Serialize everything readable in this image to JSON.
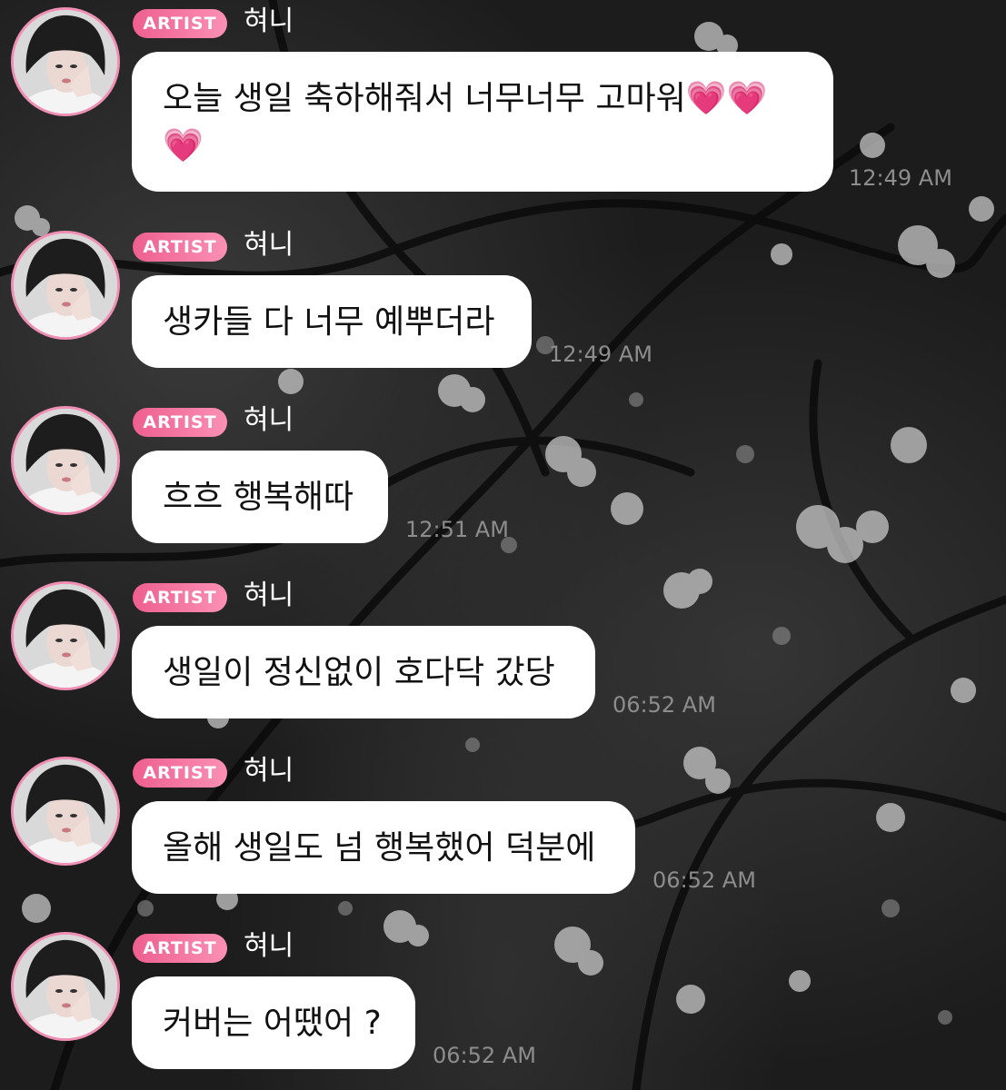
{
  "chat": {
    "messages": [
      {
        "badge": "ARTIST",
        "name": "혀니",
        "text": "오늘 생일 축하해줘서 너무너무 고마워💗💗💗",
        "time": "12:49 AM"
      },
      {
        "badge": "ARTIST",
        "name": "혀니",
        "text": "생카들 다 너무 예뿌더라",
        "time": "12:49 AM"
      },
      {
        "badge": "ARTIST",
        "name": "혀니",
        "text": "흐흐 행복해따",
        "time": "12:51 AM"
      },
      {
        "badge": "ARTIST",
        "name": "혀니",
        "text": "생일이 정신없이 호다닥 갔당",
        "time": "06:52 AM"
      },
      {
        "badge": "ARTIST",
        "name": "혀니",
        "text": "올해 생일도 넘 행복했어 덕분에",
        "time": "06:52 AM"
      },
      {
        "badge": "ARTIST",
        "name": "혀니",
        "text": "커버는 어땠어 ?",
        "time": "06:52 AM"
      }
    ]
  },
  "colors": {
    "badge_gradient_start": "#ee5f8f",
    "badge_gradient_end": "#fb90b4",
    "avatar_ring": "#f08fb4",
    "bubble_bg": "#ffffff",
    "timestamp": "#8d8d8d",
    "background": "#1c1c1c"
  },
  "icons": {
    "avatar": "profile-photo",
    "background": "blossom-branch-painting"
  }
}
